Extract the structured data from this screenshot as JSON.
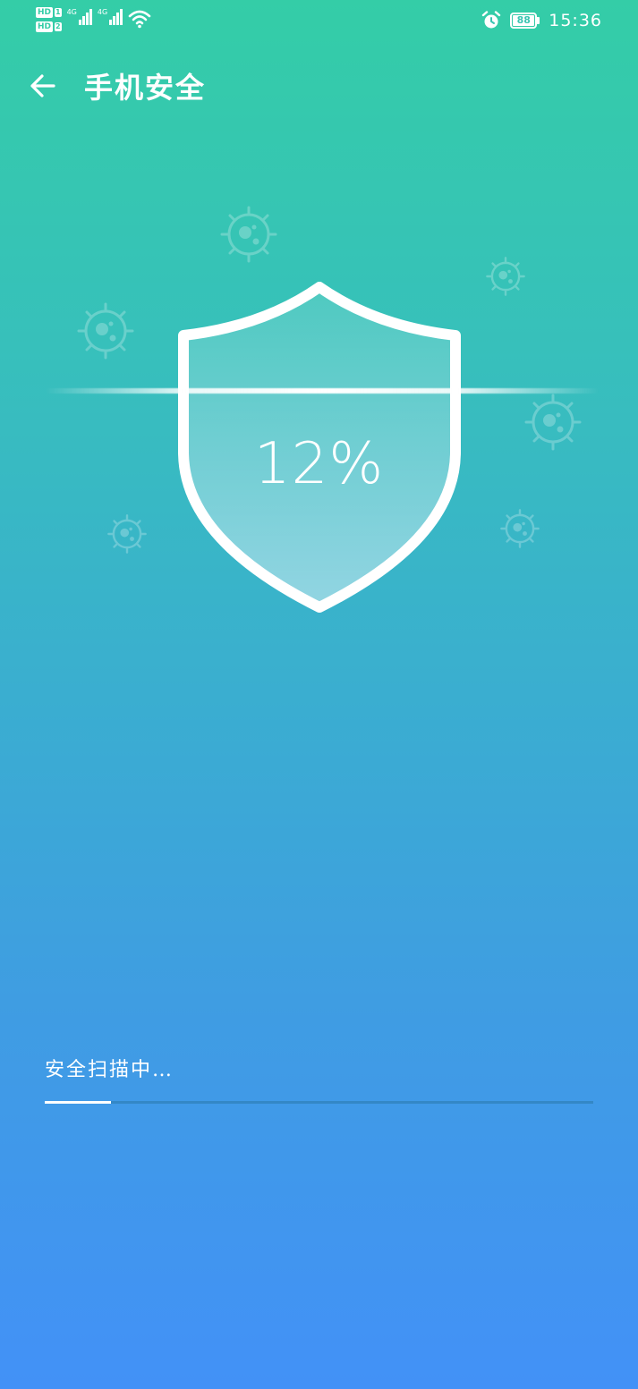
{
  "status_bar": {
    "hd1": "HD",
    "hd1_num": "1",
    "hd2": "HD",
    "hd2_num": "2",
    "net1": "4G",
    "net2": "4G",
    "battery": "88",
    "time": "15:36",
    "icons": [
      "signal-icon",
      "wifi-icon",
      "alarm-icon",
      "battery-icon"
    ]
  },
  "header": {
    "back_icon": "back-arrow-icon",
    "title": "手机安全"
  },
  "scan": {
    "percent": "12%",
    "status": "安全扫描中…",
    "progress": 0.12
  },
  "colors": {
    "gradient_top": "#34cda7",
    "gradient_bottom": "#4291f7",
    "foreground": "#ffffff"
  }
}
